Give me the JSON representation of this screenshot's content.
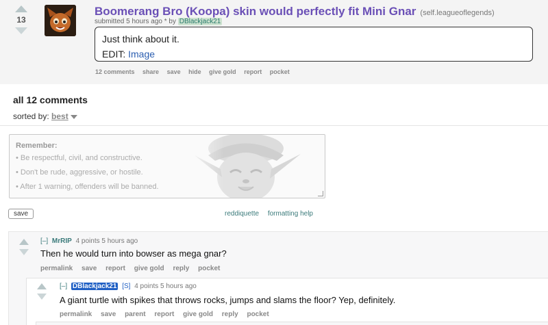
{
  "post": {
    "score": "13",
    "title": "Boomerang Bro (Koopa) skin would perfectly fit Mini Gnar",
    "domain": "(self.leagueoflegends)",
    "submitted_prefix": "submitted 5 hours ago * by",
    "author": "DBlackjack21",
    "selftext_line1": "Just think about it.",
    "selftext_edit": "EDIT:",
    "selftext_link": "Image",
    "buttons": [
      "12 comments",
      "share",
      "save",
      "hide",
      "give gold",
      "report",
      "pocket"
    ]
  },
  "comments_header": {
    "title": "all 12 comments",
    "sorted_label": "sorted by:",
    "sorted_value": "best"
  },
  "comment_box": {
    "rules_title": "Remember:",
    "rules": [
      "• Be respectful, civil, and constructive.",
      "• Don't be rude, aggressive, or hostile.",
      "• After 1 warning, offenders will be banned."
    ],
    "save_label": "save",
    "links": [
      "reddiquette",
      "formatting help"
    ]
  },
  "comments": [
    {
      "toggle": "[–]",
      "author": "MrRIP",
      "meta": "4 points 5 hours ago",
      "body": "Then he would turn into bowser as mega gnar?",
      "buttons": [
        "permalink",
        "save",
        "report",
        "give gold",
        "reply",
        "pocket"
      ]
    },
    {
      "toggle": "[–]",
      "author": "DBlackjack21",
      "submitter_tag": "[S]",
      "meta": "4 points 5 hours ago",
      "body": "A giant turtle with spikes that throws rocks, jumps and slams the floor? Yep, definitely.",
      "buttons": [
        "permalink",
        "save",
        "parent",
        "report",
        "give gold",
        "reply",
        "pocket"
      ]
    }
  ],
  "colors": {
    "title": "#6a4fb6",
    "link": "#3a7a7a",
    "op_badge": "#1f5fc4"
  }
}
